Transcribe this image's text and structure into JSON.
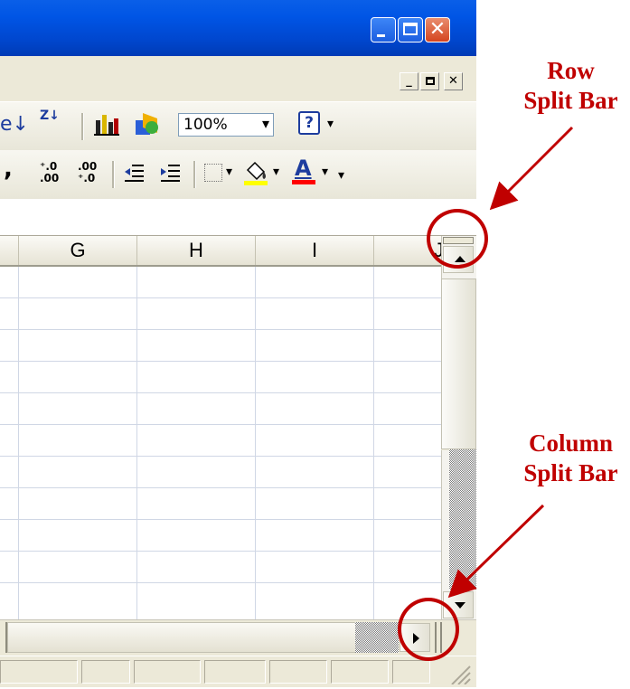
{
  "window": {
    "caption_buttons": [
      "minimize-icon",
      "maximize-icon",
      "close-icon"
    ],
    "close_glyph": "✕"
  },
  "workbook_controls": {
    "minimize_glyph": "_",
    "restore_glyph": "🗗",
    "close_glyph": "✕"
  },
  "toolbar_standard": {
    "sort_desc_glyph": "↓",
    "sort_za_label": "Z↓",
    "zoom_value": "100%",
    "dropdown_glyph": "▾",
    "help_glyph": "?"
  },
  "toolbar_formatting": {
    "comma_label": ",",
    "increase_decimal_label": "⁺.0 .00",
    "decrease_decimal_label": ".00 ⁺.0",
    "font_color_label": "A",
    "dropdown_glyph": "▾"
  },
  "columns": [
    "G",
    "H",
    "I",
    "J"
  ],
  "annotations": {
    "row_split_bar": [
      "Row",
      "Split Bar"
    ],
    "column_split_bar": [
      "Column",
      "Split Bar"
    ]
  },
  "colors": {
    "accent_red": "#c00000",
    "title_blue": "#0055e5",
    "chrome": "#ece9d8"
  }
}
